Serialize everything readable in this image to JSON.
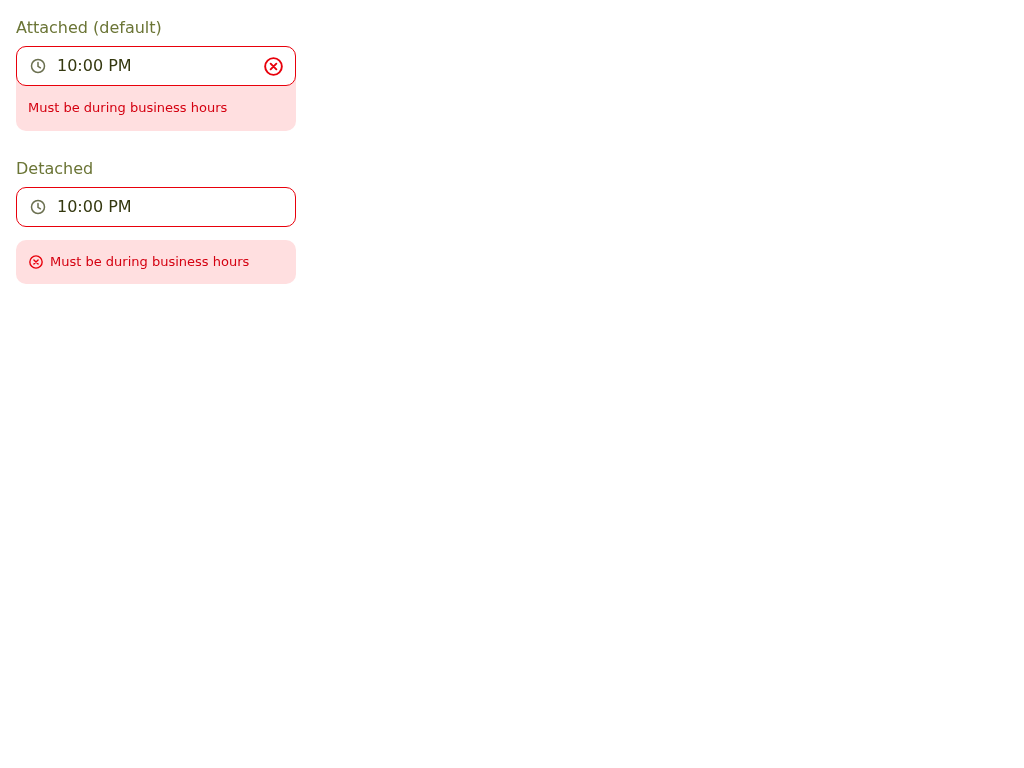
{
  "fields": [
    {
      "label": "Attached (default)",
      "value": "10:00 PM",
      "invalid": true,
      "clearable": true,
      "error": {
        "kind": "attached",
        "message": "Must be during business hours"
      }
    },
    {
      "label": "Detached",
      "value": "10:00 PM",
      "invalid": true,
      "clearable": false,
      "error": {
        "kind": "detached",
        "message": "Must be during business hours"
      }
    }
  ]
}
